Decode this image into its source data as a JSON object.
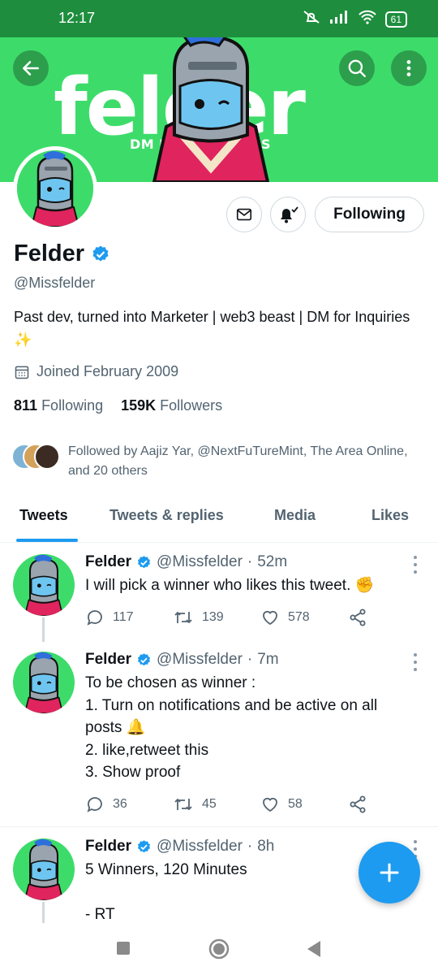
{
  "status_bar": {
    "time": "12:17",
    "battery": "61"
  },
  "banner": {
    "word": "felder",
    "subtitle": "DM FOR BUSINESS"
  },
  "profile": {
    "name": "Felder",
    "handle": "@Missfelder",
    "bio": "Past dev, turned into Marketer | web3 beast | DM for Inquiries ✨",
    "joined": "Joined February 2009",
    "following_count": "811",
    "following_label": "Following",
    "followers_count": "159K",
    "followers_label": "Followers",
    "followed_by": "Followed by Aajiz Yar, @NextFuTureMint, The Area Online, and 20 others",
    "follow_button": "Following"
  },
  "tabs": [
    {
      "label": "Tweets",
      "active": true
    },
    {
      "label": "Tweets & replies",
      "active": false
    },
    {
      "label": "Media",
      "active": false
    },
    {
      "label": "Likes",
      "active": false
    }
  ],
  "tweets": [
    {
      "name": "Felder",
      "handle": "@Missfelder",
      "time": "52m",
      "text": "I will pick a winner who likes this tweet. ✊",
      "replies": "117",
      "retweets": "139",
      "likes": "578"
    },
    {
      "name": "Felder",
      "handle": "@Missfelder",
      "time": "7m",
      "text": "To be chosen as winner :\n1. Turn on notifications and be active on all posts 🔔\n2. like,retweet this\n3. Show proof",
      "replies": "36",
      "retweets": "45",
      "likes": "58"
    },
    {
      "name": "Felder",
      "handle": "@Missfelder",
      "time": "8h",
      "text": "5 Winners, 120 Minutes\n\n- RT"
    }
  ],
  "colors": {
    "accent": "#1d9bf0",
    "banner_green": "#3ddc6a",
    "status_green": "#1e8e3e"
  }
}
